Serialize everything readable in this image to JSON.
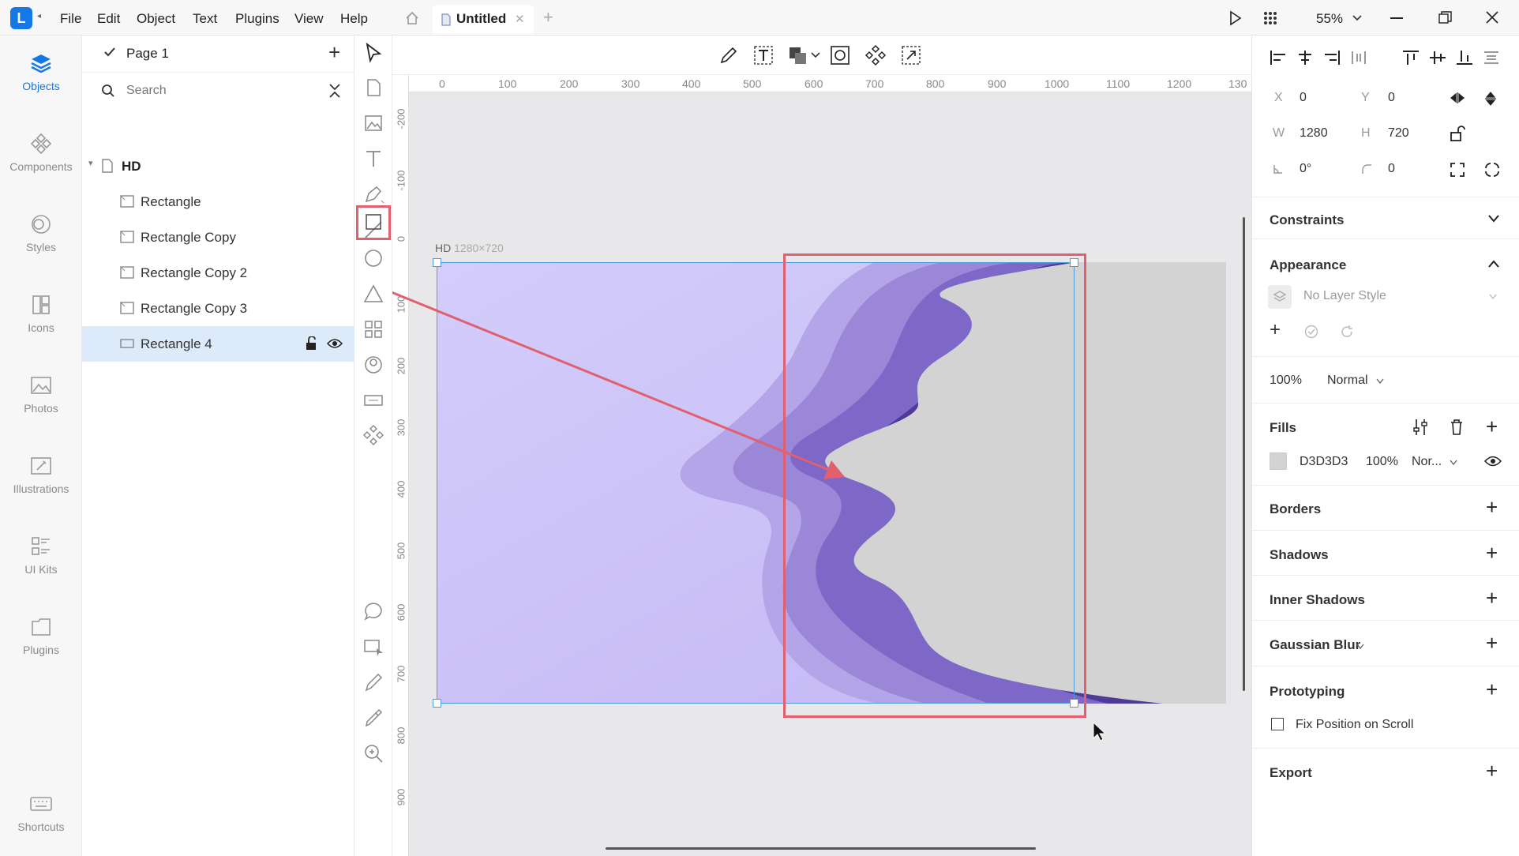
{
  "menu": {
    "items": [
      "File",
      "Edit",
      "Object",
      "Text",
      "Plugins",
      "View",
      "Help"
    ],
    "doc_tab": "Untitled",
    "zoom": "55%"
  },
  "rail": {
    "items": [
      {
        "label": "Objects",
        "icon": "layers-icon"
      },
      {
        "label": "Components",
        "icon": "components-icon"
      },
      {
        "label": "Styles",
        "icon": "styles-icon"
      },
      {
        "label": "Icons",
        "icon": "icons-icon"
      },
      {
        "label": "Photos",
        "icon": "photos-icon"
      },
      {
        "label": "Illustrations",
        "icon": "illustrations-icon"
      },
      {
        "label": "UI Kits",
        "icon": "ui-kits-icon"
      },
      {
        "label": "Plugins",
        "icon": "plugins-icon"
      }
    ],
    "shortcuts": "Shortcuts"
  },
  "layers": {
    "page": "Page 1",
    "search_placeholder": "Search",
    "artboard": "HD",
    "items": [
      "Rectangle",
      "Rectangle Copy",
      "Rectangle Copy 2",
      "Rectangle Copy 3",
      "Rectangle 4"
    ],
    "selected_index": 4
  },
  "canvas": {
    "artboard_name": "HD",
    "artboard_size": "1280×720",
    "ruler_h": [
      "0",
      "100",
      "200",
      "300",
      "400",
      "500",
      "600",
      "700",
      "800",
      "900",
      "1000",
      "1100",
      "1200",
      "130"
    ],
    "ruler_v": [
      "-200",
      "-100",
      "0",
      "100",
      "200",
      "300",
      "400",
      "500",
      "600",
      "700",
      "800",
      "900"
    ],
    "artboard_gradient": [
      "#d4cdfa",
      "#c2b6f4"
    ],
    "wave_colors": [
      "#b4a5e8",
      "#9a87d8",
      "#7d67c7",
      "#4e3a98"
    ],
    "fill_color": "#d3d3d3",
    "annotation_color": "#e06070",
    "selection_color": "#4a9ee0"
  },
  "props": {
    "x_label": "X",
    "x": "0",
    "y_label": "Y",
    "y": "0",
    "w_label": "W",
    "w": "1280",
    "h_label": "H",
    "h": "720",
    "rotation": "0°",
    "radius": "0",
    "constraints": "Constraints",
    "appearance": "Appearance",
    "layer_style": "No Layer Style",
    "opacity": "100%",
    "blend": "Normal",
    "fills": "Fills",
    "fill_hex": "D3D3D3",
    "fill_opacity": "100%",
    "fill_blend": "Nor...",
    "borders": "Borders",
    "shadows": "Shadows",
    "inner_shadows": "Inner Shadows",
    "gaussian_blur": "Gaussian Blur",
    "prototyping": "Prototyping",
    "fix_position": "Fix Position on Scroll",
    "export": "Export"
  }
}
